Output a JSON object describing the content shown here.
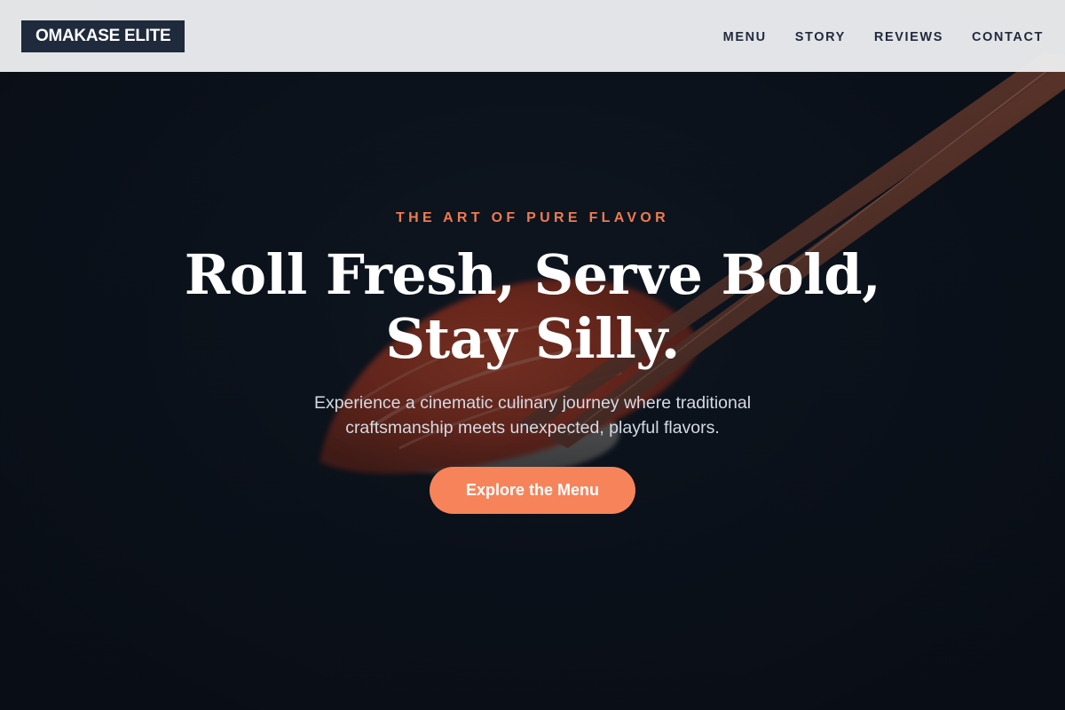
{
  "header": {
    "brand": "OMAKASE ELITE",
    "nav": [
      {
        "label": "MENU"
      },
      {
        "label": "STORY"
      },
      {
        "label": "REVIEWS"
      },
      {
        "label": "CONTACT"
      }
    ]
  },
  "hero": {
    "eyebrow": "THE ART OF PURE FLAVOR",
    "headline_line1": "Roll Fresh, Serve Bold,",
    "headline_line2": "Stay Silly.",
    "subtitle": "Experience a cinematic culinary journey where traditional craftsmanship meets unexpected, playful flavors.",
    "cta_label": "Explore the Menu",
    "background_image": "sushi-with-chopsticks"
  },
  "colors": {
    "accent": "#f7835a",
    "eyebrow": "#f07b4f",
    "brand_bg": "#1f2a3c",
    "nav_bg": "#ecedef",
    "hero_bg": "#0c131d"
  }
}
